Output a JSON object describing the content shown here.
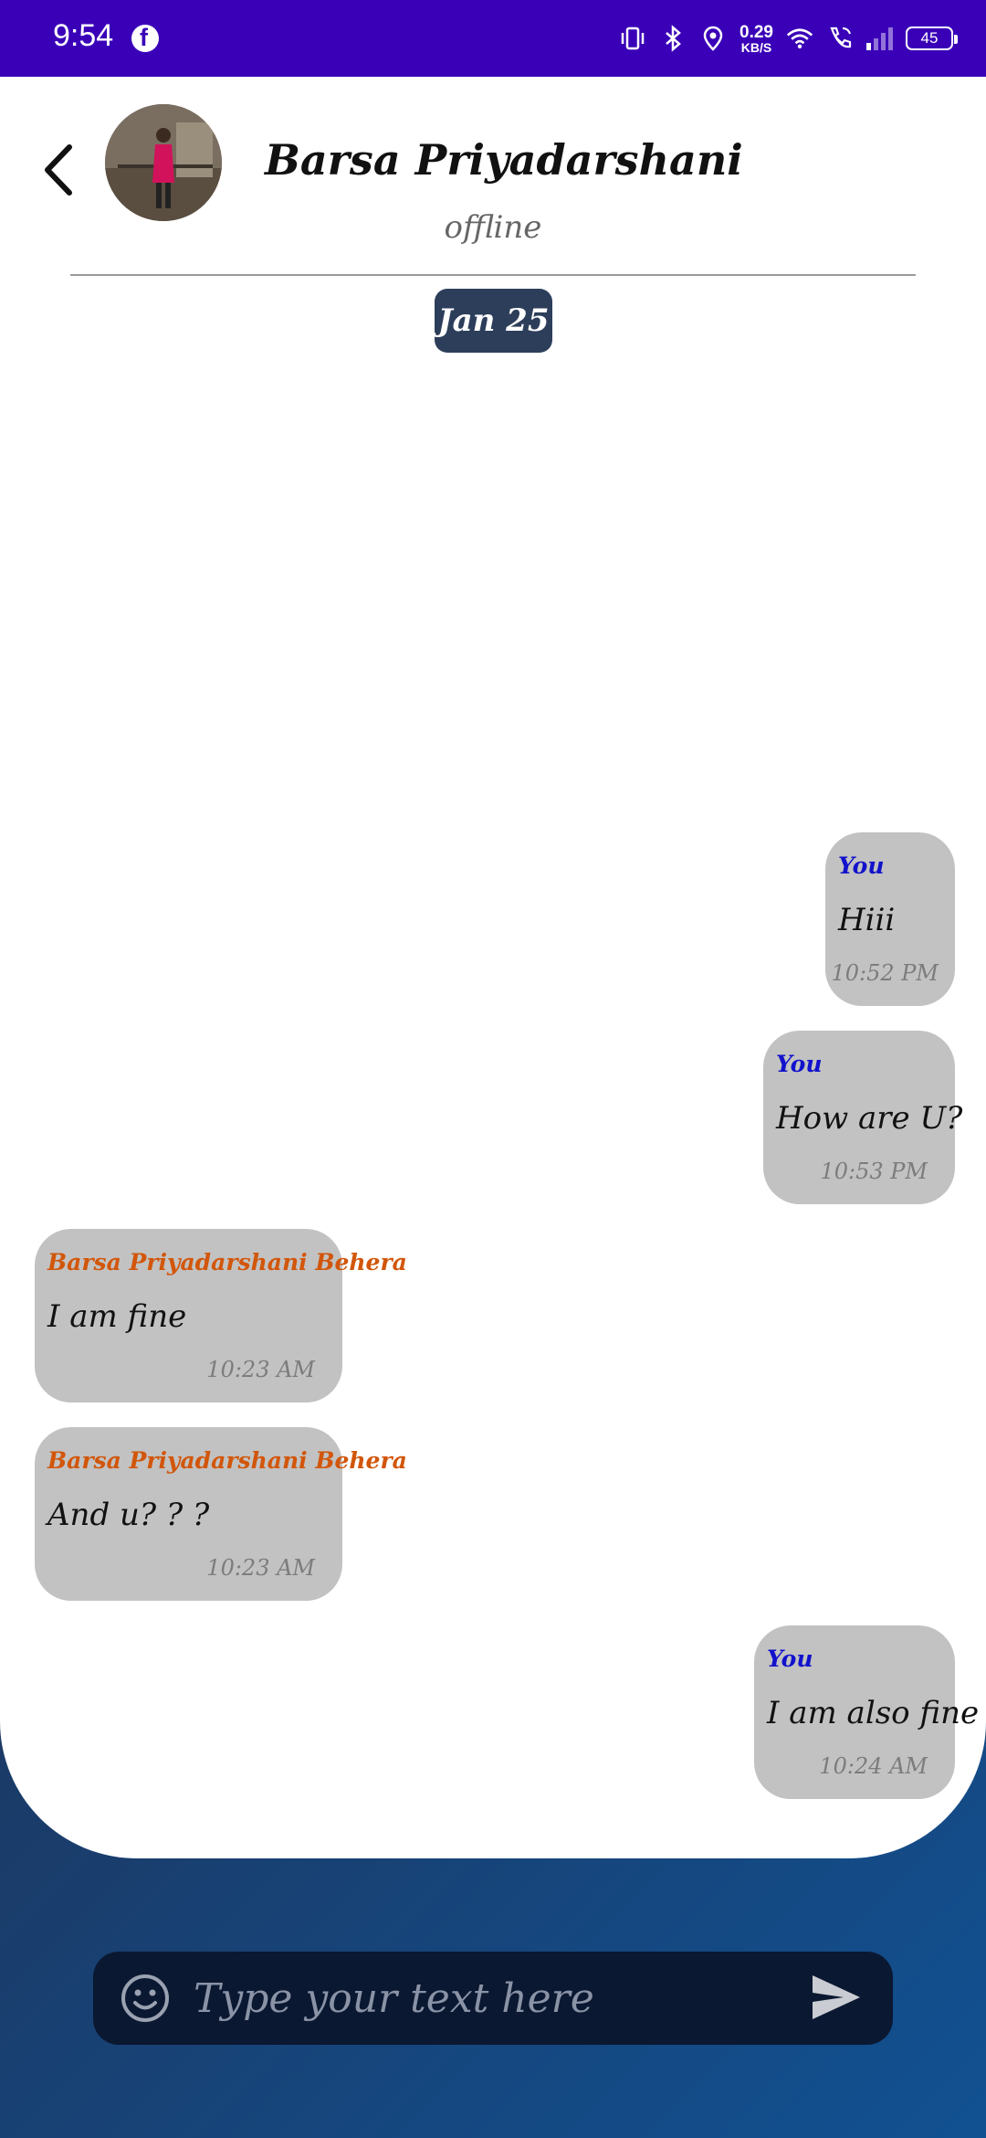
{
  "status_bar": {
    "time": "9:54",
    "network_speed": "0.29",
    "network_speed_unit": "KB/S",
    "battery": "45",
    "icons": [
      "facebook-icon",
      "vibrate-icon",
      "bluetooth-icon",
      "location-icon",
      "wifi-icon",
      "wifi-calling-icon",
      "signal-icon",
      "battery-icon"
    ]
  },
  "header": {
    "contact_name": "Barsa Priyadarshani",
    "status": "offline",
    "back_icon": "chevron-left-icon",
    "avatar": "contact-avatar"
  },
  "date_chip": "Jan 25",
  "messages": [
    {
      "direction": "out",
      "sender": "You",
      "text": "Hiii",
      "time": "10:52 PM"
    },
    {
      "direction": "out",
      "sender": "You",
      "text": "How are U?",
      "time": "10:53 PM"
    },
    {
      "direction": "in",
      "sender": "Barsa Priyadarshani Behera",
      "text": "I am fine",
      "time": "10:23 AM"
    },
    {
      "direction": "in",
      "sender": "Barsa Priyadarshani Behera",
      "text": "And u? ? ?",
      "time": "10:23 AM"
    },
    {
      "direction": "out",
      "sender": "You",
      "text": "I am also fine",
      "time": "10:24 AM"
    }
  ],
  "composer": {
    "placeholder": "Type your text here",
    "emoji_icon": "emoji-icon",
    "send_icon": "send-icon"
  },
  "colors": {
    "status_bar": "#3a00b8",
    "bubble": "#c2c2c2",
    "outgoing_sender": "#1212cc",
    "incoming_sender": "#d2560a",
    "date_chip": "#2c3e5a",
    "composer": "#0b1832"
  }
}
